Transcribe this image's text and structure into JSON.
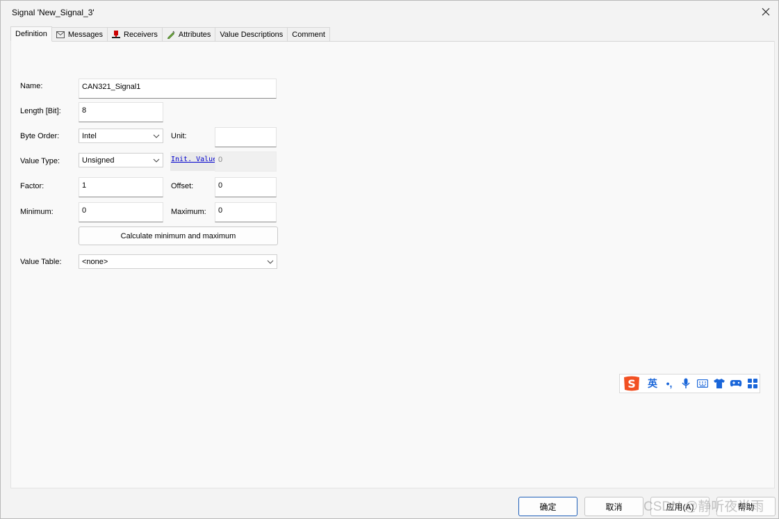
{
  "window": {
    "title": "Signal 'New_Signal_3'"
  },
  "tabs": [
    {
      "label": "Definition",
      "icon": ""
    },
    {
      "label": "Messages",
      "icon": "envelope-icon"
    },
    {
      "label": "Receivers",
      "icon": "receiver-icon"
    },
    {
      "label": "Attributes",
      "icon": "pencil-icon"
    },
    {
      "label": "Value Descriptions",
      "icon": ""
    },
    {
      "label": "Comment",
      "icon": ""
    }
  ],
  "form": {
    "name_label": "Name:",
    "name_value": "CAN321_Signal1",
    "length_label": "Length [Bit]:",
    "length_value": "8",
    "byte_order_label": "Byte Order:",
    "byte_order_value": "Intel",
    "unit_label": "Unit:",
    "unit_value": "",
    "value_type_label": "Value Type:",
    "value_type_value": "Unsigned",
    "init_value_label": "Init. Value",
    "init_value_value": "0",
    "factor_label": "Factor:",
    "factor_value": "1",
    "offset_label": "Offset:",
    "offset_value": "0",
    "minimum_label": "Minimum:",
    "minimum_value": "0",
    "maximum_label": "Maximum:",
    "maximum_value": "0",
    "calc_button": "Calculate minimum and maximum",
    "value_table_label": "Value Table:",
    "value_table_value": "<none>"
  },
  "ime_toolbar": {
    "lang": "英",
    "punct": "•,",
    "icons": [
      "sogou-logo-icon",
      "microphone-icon",
      "keyboard-icon",
      "shirt-icon",
      "gamepad-icon",
      "grid-icon"
    ]
  },
  "footer": {
    "ok": "确定",
    "cancel": "取消",
    "apply": "应用(A)",
    "help": "帮助"
  },
  "watermark": "CSDN @静听夜半雨",
  "colors": {
    "accent": "#1f5fb8",
    "link": "#0000cc",
    "sogou": "#f25022"
  }
}
